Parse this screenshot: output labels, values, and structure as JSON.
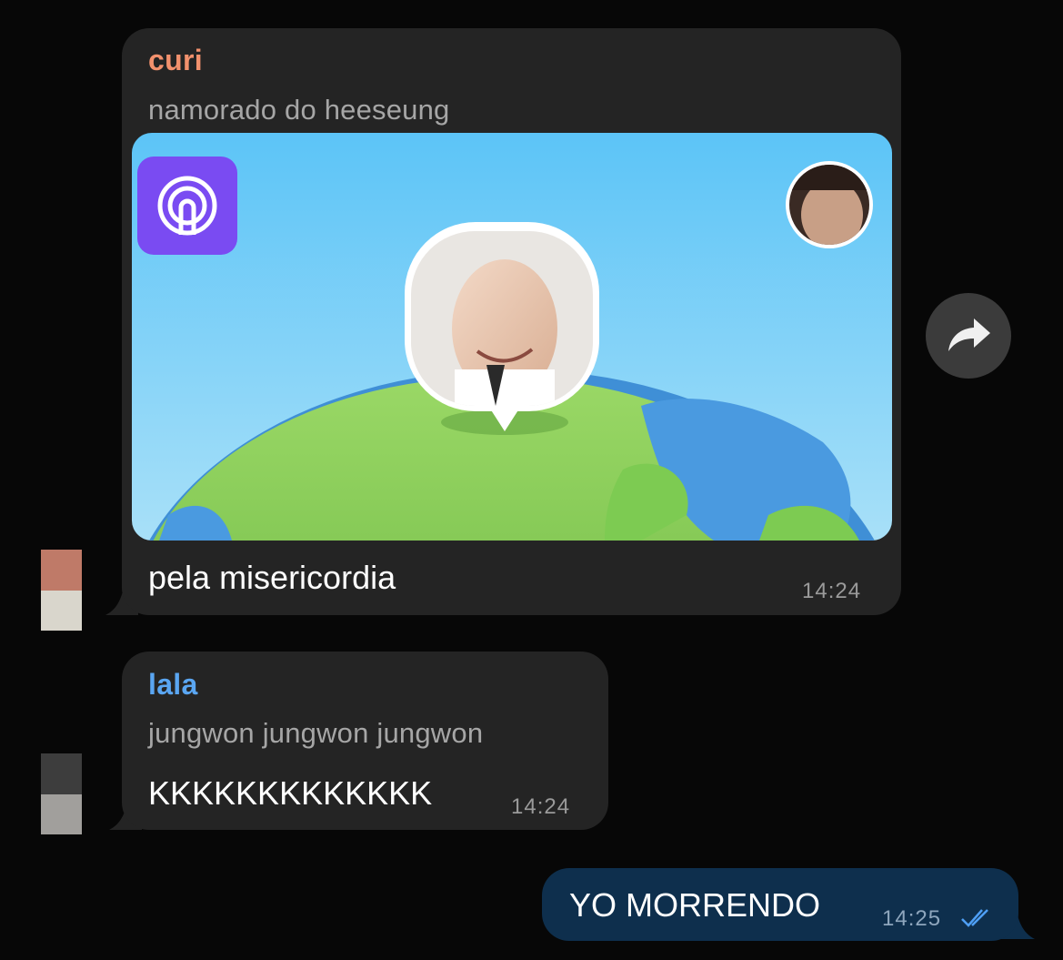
{
  "messages": [
    {
      "sender": "curi",
      "sender_color": "#f2916d",
      "subtitle": "namorado do heeseung",
      "text": "pela misericordia",
      "time": "14:24",
      "has_media": true,
      "avatar_colors": [
        "#bf7a68",
        "#d9d6cc"
      ]
    },
    {
      "sender": "lala",
      "sender_color": "#5aa6f2",
      "subtitle": "jungwon jungwon jungwon",
      "text": "KKKKKKKKKKKKK",
      "time": "14:24",
      "avatar_colors": [
        "#3d3d3d",
        "#a19f9c"
      ]
    }
  ],
  "outgoing": {
    "text": "YO MORRENDO",
    "time": "14:25",
    "status_icon": "double-check-icon",
    "bubble_color": "#0e2f4d",
    "check_color": "#4e9ff5"
  },
  "media": {
    "app_icon": "life360-app-icon",
    "sky_color": "#7ed0f6",
    "globe_color": "#7dcb52"
  },
  "forward_icon": "share-arrow-icon"
}
